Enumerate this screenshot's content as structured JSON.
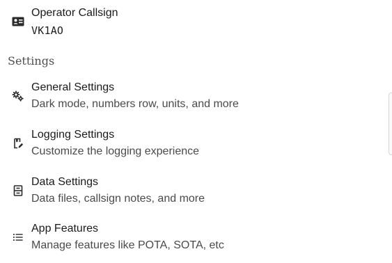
{
  "callsign": {
    "icon": "contact-card-icon",
    "title": "Operator Callsign",
    "value": "VK1AO"
  },
  "settings_section": {
    "header": "Settings",
    "items": [
      {
        "id": "general",
        "icon": "gears-icon",
        "title": "General Settings",
        "subtitle": "Dark mode, numbers row, units, and more"
      },
      {
        "id": "logging",
        "icon": "book-edit-icon",
        "title": "Logging Settings",
        "subtitle": "Customize the logging experience"
      },
      {
        "id": "data",
        "icon": "database-icon",
        "title": "Data Settings",
        "subtitle": "Data files, callsign notes, and more"
      },
      {
        "id": "features",
        "icon": "list-icon",
        "title": "App Features",
        "subtitle": "Manage features like POTA, SOTA, etc"
      }
    ]
  }
}
